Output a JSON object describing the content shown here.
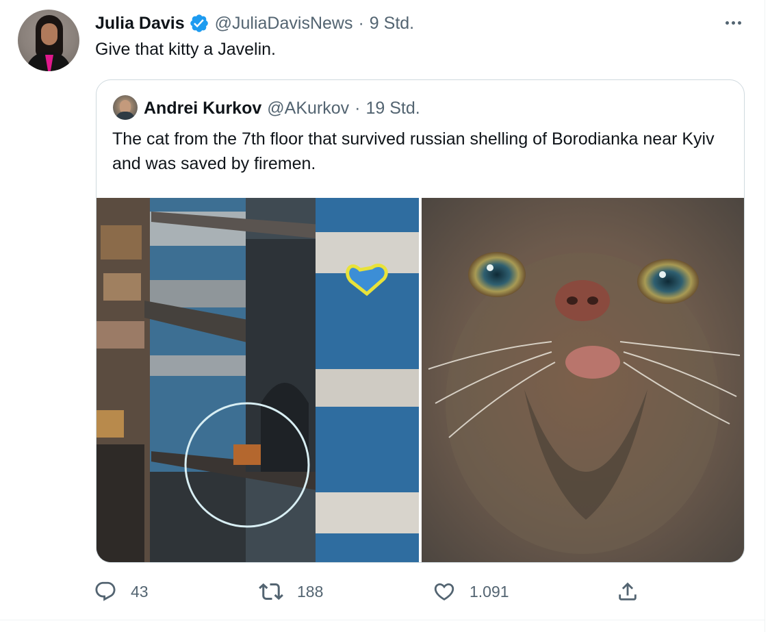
{
  "tweet": {
    "author_name": "Julia Davis",
    "author_handle": "@JuliaDavisNews",
    "separator": "·",
    "time": "9 Std.",
    "text": "Give that kitty a Javelin."
  },
  "quoted_tweet": {
    "author_name": "Andrei Kurkov",
    "author_handle": "@AKurkov",
    "separator": "·",
    "time": "19 Std.",
    "text": "The cat from the 7th floor that survived russian shelling of Borodianka near Kyiv and was saved by firemen."
  },
  "actions": {
    "reply_count": "43",
    "retweet_count": "188",
    "like_count": "1.091"
  },
  "colors": {
    "accent_blue": "#1d9bf0",
    "muted_text": "#536471",
    "border": "#cfd9de"
  },
  "icons": [
    "verified-badge-icon",
    "more-options-icon",
    "reply-icon",
    "retweet-icon",
    "like-icon",
    "share-icon"
  ]
}
